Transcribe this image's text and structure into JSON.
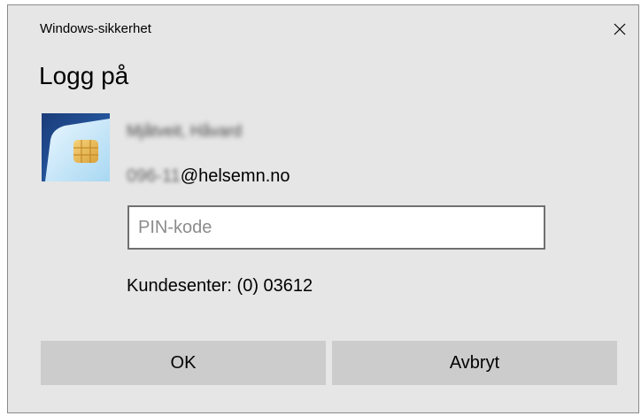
{
  "window": {
    "title": "Windows-sikkerhet",
    "close_icon": "close-icon"
  },
  "dialog": {
    "heading": "Logg på",
    "card_icon": "smartcard-icon",
    "user": {
      "name": "Mjåtveit, Håvard",
      "email_prefix": "096-11",
      "email_domain": "@helsemn.no"
    },
    "pin": {
      "value": "",
      "placeholder": "PIN-kode"
    },
    "support": "Kundesenter: (0) 03612",
    "buttons": {
      "ok": "OK",
      "cancel": "Avbryt"
    }
  },
  "colors": {
    "dialog_bg": "#e6e6e6",
    "button_bg": "#cccccc",
    "input_border": "#707070"
  }
}
